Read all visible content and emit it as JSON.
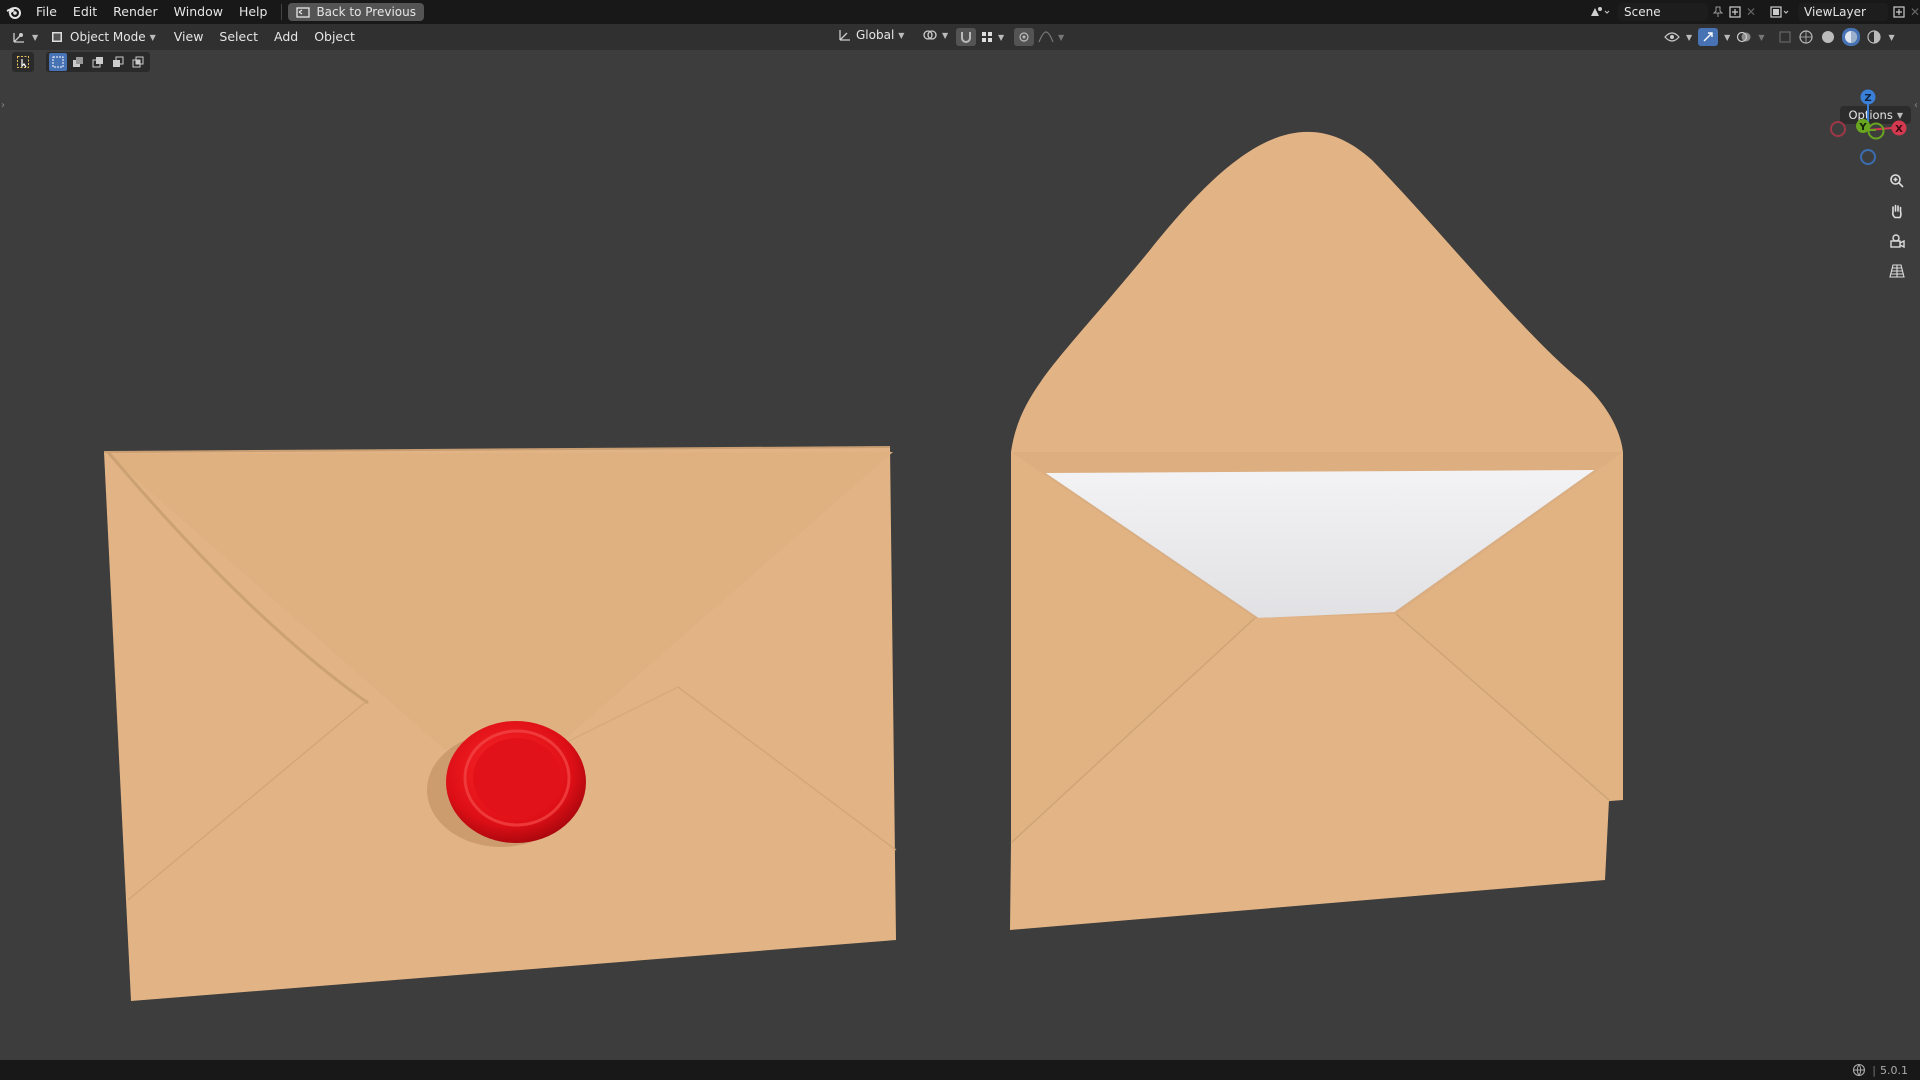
{
  "topbar": {
    "menus": [
      "File",
      "Edit",
      "Render",
      "Window",
      "Help"
    ],
    "back_button": "Back to Previous",
    "scene_name": "Scene",
    "view_layer": "ViewLayer"
  },
  "header": {
    "mode": "Object Mode",
    "menus": [
      "View",
      "Select",
      "Add",
      "Object"
    ],
    "transform_orientation": "Global"
  },
  "viewport": {
    "options_label": "Options",
    "gizmo": {
      "z": "Z",
      "y": "Y",
      "x": "X"
    },
    "colors": {
      "envelope": "#E2B485",
      "wax_seal": "#E0121A",
      "letter": "#E9E9EC",
      "background": "#3D3D3D"
    }
  },
  "statusbar": {
    "version": "5.0.1"
  }
}
